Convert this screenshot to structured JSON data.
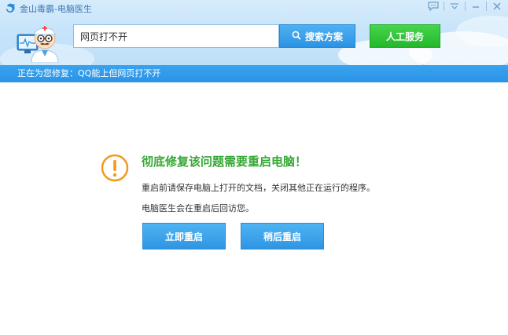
{
  "app": {
    "title": "金山毒霸-电脑医生"
  },
  "search": {
    "value": "网页打不开",
    "button_label": "搜索方案"
  },
  "service": {
    "button_label": "人工服务"
  },
  "status": {
    "text": "正在为您修复：QQ能上但网页打不开"
  },
  "message": {
    "title": "彻底修复该问题需要重启电脑！",
    "line1": "重启前请保存电脑上打开的文档，关闭其他正在运行的程序。",
    "line2": "电脑医生会在重启后回访您。"
  },
  "actions": {
    "restart_now": "立即重启",
    "restart_later": "稍后重启"
  },
  "icons": {
    "app": "kingsoft-logo-icon",
    "feedback": "chat-bubble-icon",
    "menu": "menu-icon",
    "minimize": "minimize-icon",
    "close": "close-icon",
    "search": "search-icon",
    "warning": "warning-icon",
    "mascot": "doctor-mascot-icon"
  },
  "colors": {
    "accent_blue": "#2b93e3",
    "service_green": "#24b62b",
    "title_green": "#35a835",
    "warning_orange": "#f39a1d",
    "status_bar": "#3aa3ee"
  }
}
